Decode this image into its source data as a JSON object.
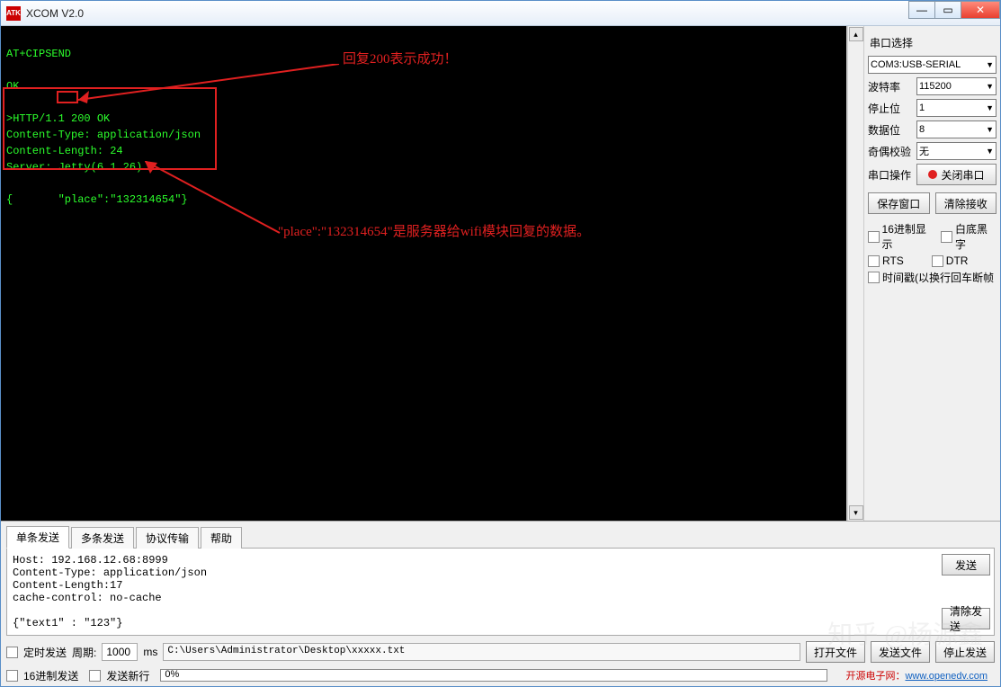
{
  "window": {
    "title": "XCOM V2.0",
    "icon_text": "ATK"
  },
  "terminal": {
    "lines": "AT+CIPSEND\n\nOK\n\n>HTTP/1.1 200 OK\nContent-Type: application/json\nContent-Length: 24\nServer: Jetty(6.1.26)\n\n{       \"place\":\"132314654\"}"
  },
  "annotations": {
    "a1": "回复200表示成功！",
    "a2": "\"place\":\"132314654\"是服务器给wifi模块回复的数据。"
  },
  "sidebar": {
    "section_title": "串口选择",
    "port_value": "COM3:USB-SERIAL",
    "rows": {
      "baud": {
        "label": "波特率",
        "value": "115200"
      },
      "stop": {
        "label": "停止位",
        "value": "1"
      },
      "data": {
        "label": "数据位",
        "value": "8"
      },
      "parity": {
        "label": "奇偶校验",
        "value": "无"
      },
      "op": {
        "label": "串口操作",
        "value": "关闭串口"
      }
    },
    "btn_save": "保存窗口",
    "btn_clear": "清除接收",
    "chk_hex": "16进制显示",
    "chk_wb": "白底黑字",
    "chk_rts": "RTS",
    "chk_dtr": "DTR",
    "chk_ts": "时间戳(以换行回车断帧"
  },
  "tabs": {
    "t1": "单条发送",
    "t2": "多条发送",
    "t3": "协议传输",
    "t4": "帮助"
  },
  "send": {
    "text": "Host: 192.168.12.68:8999\nContent-Type: application/json\nContent-Length:17\ncache-control: no-cache\n\n{\"text1\" : \"123\"}",
    "btn_send": "发送",
    "btn_clear_send": "清除发送"
  },
  "bottom": {
    "chk_timed": "定时发送",
    "period_label": "周期:",
    "period_value": "1000",
    "period_unit": "ms",
    "path": "C:\\Users\\Administrator\\Desktop\\xxxxx.txt",
    "btn_open": "打开文件",
    "btn_sendfile": "发送文件",
    "btn_stop": "停止发送",
    "chk_hexsend": "16进制发送",
    "chk_newline": "发送新行",
    "progress": "0%"
  },
  "footer": {
    "text": "开源电子网：",
    "url": "www.openedv.com"
  },
  "watermark": "知乎 @杨源鑫"
}
